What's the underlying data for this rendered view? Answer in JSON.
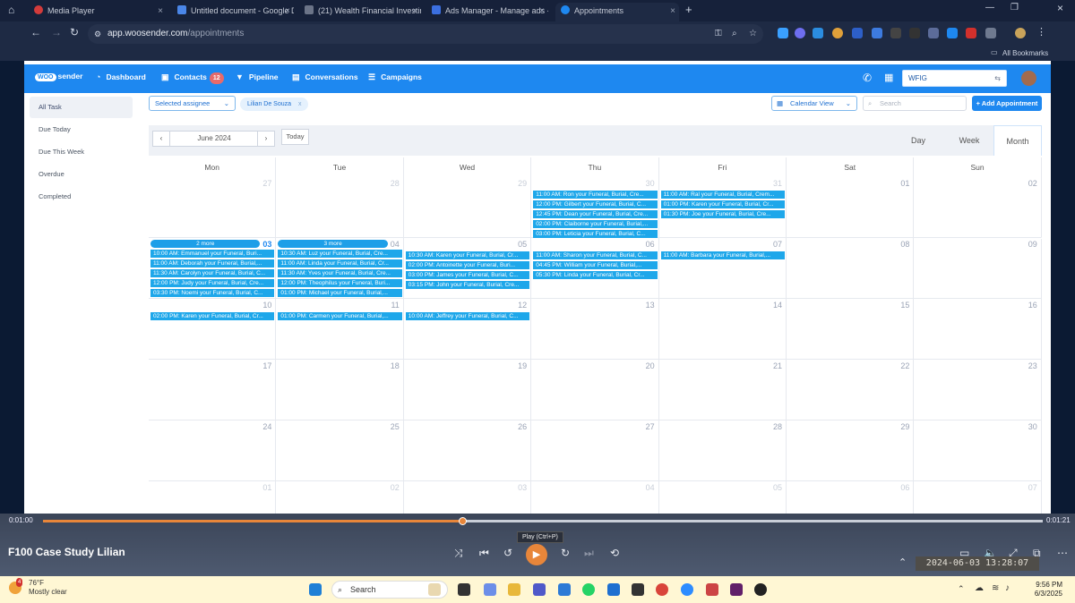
{
  "browser": {
    "tabs": [
      {
        "title": "Media Player",
        "active": false
      },
      {
        "title": "Untitled document - Google D",
        "active": false
      },
      {
        "title": "(21) Wealth Financial Investing",
        "active": false
      },
      {
        "title": "Ads Manager - Manage ads - ",
        "active": false
      },
      {
        "title": "Appointments",
        "active": true
      }
    ],
    "new_tab": "+",
    "url_host": "app.woosender.com",
    "url_path": "/appointments",
    "bookmarks_label": "All Bookmarks"
  },
  "app": {
    "logo_badge": "WOO",
    "logo_text": "sender",
    "nav": {
      "dashboard": "Dashboard",
      "contacts": "Contacts",
      "contacts_count": "12",
      "pipeline": "Pipeline",
      "conversations": "Conversations",
      "campaigns": "Campaigns"
    },
    "account_select": "WFIG",
    "sidebar": [
      "All Task",
      "Due Today",
      "Due This Week",
      "Overdue",
      "Completed"
    ],
    "filters": {
      "assignee_placeholder": "Selected assignee",
      "chip": "Lilian De Souza",
      "chip_remove": "x",
      "view_select": "Calendar View",
      "search_placeholder": "Search",
      "add_button": "+ Add Appointment"
    },
    "calendar": {
      "month_label": "June 2024",
      "today": "Today",
      "views": [
        "Day",
        "Week",
        "Month"
      ],
      "active_view": "Month",
      "weekdays": [
        "Mon",
        "Tue",
        "Wed",
        "Thu",
        "Fri",
        "Sat",
        "Sun"
      ],
      "weeks": [
        [
          {
            "day": "27",
            "other": true,
            "events": []
          },
          {
            "day": "28",
            "other": true,
            "events": []
          },
          {
            "day": "29",
            "other": true,
            "events": []
          },
          {
            "day": "30",
            "other": true,
            "events": [
              "11:00 AM: Ron your Funeral, Burial, Cre...",
              "12:00 PM: Gilbert your Funeral, Burial, C...",
              "12:45 PM: Dean your Funeral, Burial, Cre...",
              "02:00 PM: Claiborne your Funeral, Burial,...",
              "03:00 PM: Leticia your Funeral, Burial, C..."
            ]
          },
          {
            "day": "31",
            "other": true,
            "events": [
              "11:00 AM: Ral your Funeral, Burial, Crem...",
              "01:00 PM: Karen your Funeral, Burial, Cr...",
              "01:30 PM: Joe your Funeral, Burial, Cre..."
            ]
          },
          {
            "day": "01",
            "other": false,
            "events": []
          },
          {
            "day": "02",
            "other": false,
            "events": []
          }
        ],
        [
          {
            "day": "03",
            "other": false,
            "today": true,
            "more": "2 more",
            "events": [
              "10:00 AM: Emmanuel your Funeral, Buri...",
              "11:00 AM: Deborah your Funeral, Burial,...",
              "11:30 AM: Carolyn your Funeral, Burial, C...",
              "12:00 PM: Judy your Funeral, Burial, Cre...",
              "03:30 PM: Noemi your Funeral, Burial, C..."
            ]
          },
          {
            "day": "04",
            "other": false,
            "more": "3 more",
            "events": [
              "10:30 AM: Luz your Funeral, Burial, Cre...",
              "11:00 AM: Linda your Funeral, Burial, Cr...",
              "11:30 AM: Yves your Funeral, Burial, Cre...",
              "12:00 PM: Theophilus your Funeral, Buri...",
              "01:00 PM: Michael your Funeral, Burial,..."
            ]
          },
          {
            "day": "05",
            "other": false,
            "events": [
              "10:30 AM: Karen your Funeral, Burial, Cr...",
              "02:00 PM: Antoinette your Funeral, Buri...",
              "03:00 PM: James your Funeral, Burial, C...",
              "03:15 PM: John your Funeral, Burial, Cre..."
            ]
          },
          {
            "day": "06",
            "other": false,
            "events": [
              "11:00 AM: Sharon your Funeral, Burial, C...",
              "04:45 PM: William your Funeral, Burial,...",
              "05:30 PM: Linda your Funeral, Burial, Cr..."
            ]
          },
          {
            "day": "07",
            "other": false,
            "events": [
              "11:00 AM: Barbara your Funeral, Burial,..."
            ]
          },
          {
            "day": "08",
            "other": false,
            "events": []
          },
          {
            "day": "09",
            "other": false,
            "events": []
          }
        ],
        [
          {
            "day": "10",
            "other": false,
            "events": [
              "02:00 PM: Karen your Funeral, Burial, Cr..."
            ]
          },
          {
            "day": "11",
            "other": false,
            "events": [
              "01:00 PM: Carmen your Funeral, Burial,..."
            ]
          },
          {
            "day": "12",
            "other": false,
            "events": [
              "10:00 AM: Jeffrey your Funeral, Burial, C..."
            ]
          },
          {
            "day": "13",
            "other": false,
            "events": []
          },
          {
            "day": "14",
            "other": false,
            "events": []
          },
          {
            "day": "15",
            "other": false,
            "events": []
          },
          {
            "day": "16",
            "other": false,
            "events": []
          }
        ],
        [
          {
            "day": "17",
            "other": false,
            "events": []
          },
          {
            "day": "18",
            "other": false,
            "events": []
          },
          {
            "day": "19",
            "other": false,
            "events": []
          },
          {
            "day": "20",
            "other": false,
            "events": []
          },
          {
            "day": "21",
            "other": false,
            "events": []
          },
          {
            "day": "22",
            "other": false,
            "events": []
          },
          {
            "day": "23",
            "other": false,
            "events": []
          }
        ],
        [
          {
            "day": "24",
            "other": false,
            "events": []
          },
          {
            "day": "25",
            "other": false,
            "events": []
          },
          {
            "day": "26",
            "other": false,
            "events": []
          },
          {
            "day": "27",
            "other": false,
            "events": []
          },
          {
            "day": "28",
            "other": false,
            "events": []
          },
          {
            "day": "29",
            "other": false,
            "events": []
          },
          {
            "day": "30",
            "other": false,
            "events": []
          }
        ],
        [
          {
            "day": "01",
            "other": true,
            "events": []
          },
          {
            "day": "02",
            "other": true,
            "events": []
          },
          {
            "day": "03",
            "other": true,
            "events": []
          },
          {
            "day": "04",
            "other": true,
            "events": []
          },
          {
            "day": "05",
            "other": true,
            "events": []
          },
          {
            "day": "06",
            "other": true,
            "events": []
          },
          {
            "day": "07",
            "other": true,
            "events": []
          }
        ]
      ]
    }
  },
  "player": {
    "elapsed": "0:01:00",
    "total": "0:01:21",
    "progress": 0.42,
    "title": "F100 Case Study Lilian",
    "tooltip": "Play (Ctrl+P)",
    "timestamp": "2024-06-03 13:28:07"
  },
  "taskbar": {
    "temp": "76°F",
    "condition": "Mostly clear",
    "weather_badge": "4",
    "search": "Search",
    "time": "9:56 PM",
    "date": "6/3/2025"
  },
  "colors": {
    "accent": "#1e88f0",
    "event": "#1ea7ea",
    "progress": "#e8863a"
  }
}
